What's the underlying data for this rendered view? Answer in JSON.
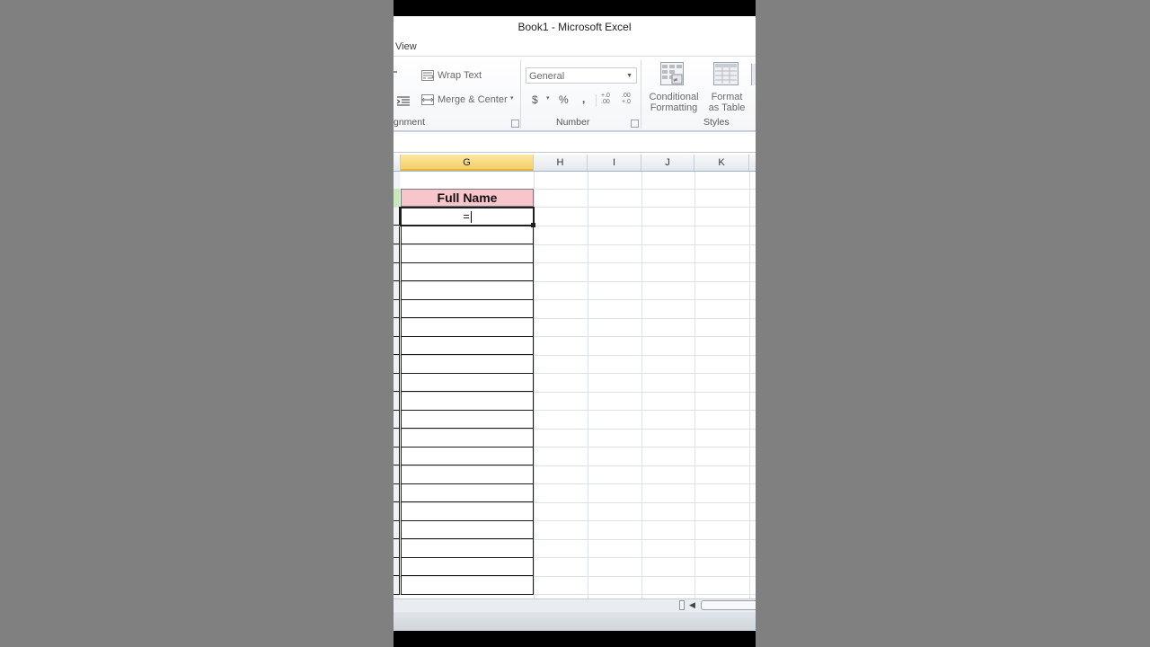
{
  "window": {
    "title": "Book1  -  Microsoft Excel"
  },
  "tabs": {
    "view": "View"
  },
  "ribbon": {
    "alignment": {
      "label": "gnment",
      "wrap_text": "Wrap Text",
      "merge_center": "Merge & Center"
    },
    "number": {
      "label": "Number",
      "format_value": "General",
      "currency": "$",
      "percent": "%",
      "comma": ",",
      "increase_decimal": "+.0 .00",
      "decrease_decimal": ".00 +.0"
    },
    "styles": {
      "label": "Styles",
      "conditional_formatting": [
        "Conditional",
        "Formatting"
      ],
      "format_as_table": [
        "Format",
        "as Table"
      ]
    }
  },
  "columns": [
    "G",
    "H",
    "I",
    "J",
    "K"
  ],
  "cells": {
    "header": "Full Name",
    "active_content": "="
  },
  "colors": {
    "header_fill": "#f8c5cc",
    "selected_column": "#f5cf66",
    "left_column_fill": "#c9e8c0"
  }
}
